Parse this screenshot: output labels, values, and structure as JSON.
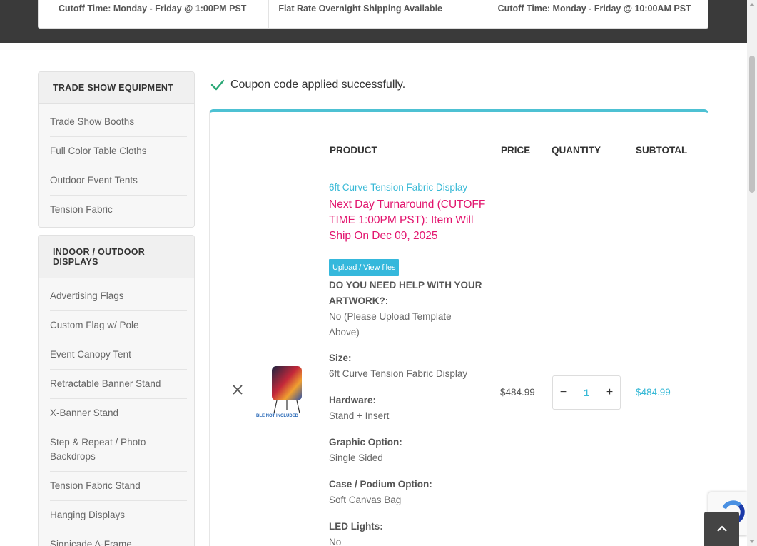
{
  "shipping_bar": [
    "Cutoff Time: Monday - Friday @ 1:00PM PST",
    "Flat Rate Overnight Shipping Available",
    "Cutoff Time: Monday - Friday @ 10:00AM PST"
  ],
  "sidebar": {
    "trade_show": {
      "title": "TRADE SHOW EQUIPMENT",
      "items": [
        "Trade Show Booths",
        "Full Color Table Cloths",
        "Outdoor Event Tents",
        "Tension Fabric"
      ]
    },
    "displays": {
      "title": "INDOOR / OUTDOOR DISPLAYS",
      "items": [
        "Advertising Flags",
        "Custom Flag w/ Pole",
        "Event Canopy Tent",
        "Retractable Banner Stand",
        "X-Banner Stand",
        "Step & Repeat / Photo Backdrops",
        "Tension Fabric Stand",
        "Hanging Displays",
        "Signicade A-Frame"
      ]
    }
  },
  "notice": "Coupon code applied successfully.",
  "cart": {
    "headers": {
      "product": "PRODUCT",
      "price": "PRICE",
      "quantity": "QUANTITY",
      "subtotal": "SUBTOTAL"
    },
    "item": {
      "name": "6ft Curve Tension Fabric Display",
      "turnaround": "Next Day Turnaround (CUTOFF TIME 1:00PM PST): Item Will Ship On Dec 09, 2025",
      "upload_label": "Upload / View files",
      "thumb_caption": "BLE NOT INCLUDED",
      "artwork_q": "DO YOU NEED HELP WITH YOUR ARTWORK?:",
      "artwork_a": "No (Please Upload Template Above)",
      "size_k": "Size:",
      "size_v": "6ft Curve Tension Fabric Display",
      "hardware_k": "Hardware:",
      "hardware_v": "Stand + Insert",
      "graphic_k": "Graphic Option:",
      "graphic_v": "Single Sided",
      "case_k": "Case / Podium Option:",
      "case_v": "Soft Canvas Bag",
      "led_k": "LED Lights:",
      "led_v": "No",
      "price": "$484.99",
      "quantity": "1",
      "subtotal": "$484.99"
    }
  },
  "colors": {
    "accent": "#38b9d6",
    "turnaround": "#e2156e",
    "check": "#2aa876"
  }
}
